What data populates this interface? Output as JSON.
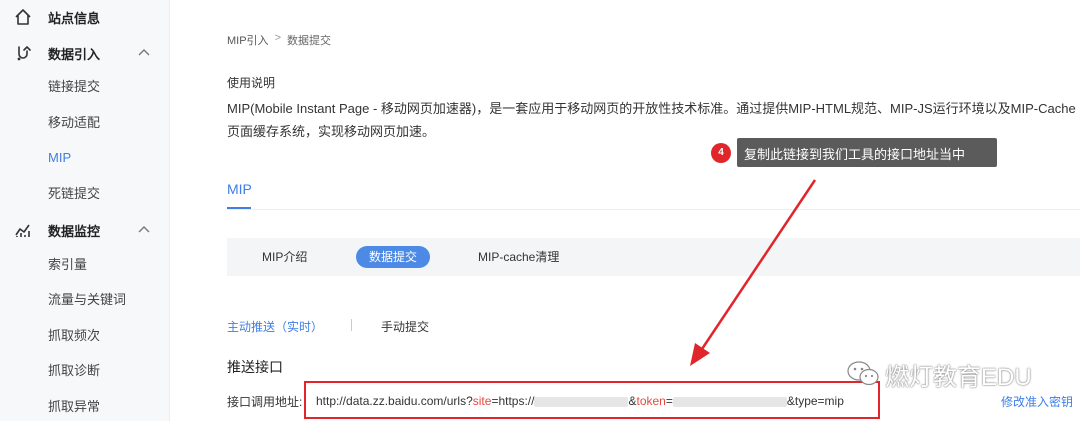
{
  "sidebar": {
    "groups": [
      {
        "label": "站点信息",
        "icon": "home-icon"
      },
      {
        "label": "数据引入",
        "icon": "data-import-icon",
        "items": [
          "链接提交",
          "移动适配",
          "MIP",
          "死链提交"
        ]
      },
      {
        "label": "数据监控",
        "icon": "data-monitor-icon",
        "items": [
          "索引量",
          "流量与关键词",
          "抓取频次",
          "抓取诊断",
          "抓取异常"
        ]
      }
    ],
    "active_item": "MIP"
  },
  "breadcrumb": {
    "parent": "MIP引入",
    "separator": ">",
    "current": "数据提交"
  },
  "usage": {
    "title": "使用说明",
    "text": "MIP(Mobile Instant Page - 移动网页加速器)，是一套应用于移动网页的开放性技术标准。通过提供MIP-HTML规范、MIP-JS运行环境以及MIP-Cache页面缓存系统，实现移动网页加速。"
  },
  "main_tab": "MIP",
  "subtabs": [
    "MIP介绍",
    "数据提交",
    "MIP-cache清理"
  ],
  "active_subtab": "数据提交",
  "push_modes": {
    "auto": "主动推送（实时）",
    "manual": "手动提交"
  },
  "push_section": {
    "title": "推送接口",
    "url_label": "接口调用地址:",
    "url_prefix": "http://data.zz.baidu.com/urls?",
    "site_key": "site",
    "site_eq": "=https://",
    "token_amp": "&",
    "token_key": "token",
    "token_eq": "=",
    "type_part": "&type=mip",
    "edit_link": "修改准入密钥"
  },
  "annotation": {
    "badge": "4",
    "text": "复制此链接到我们工具的接口地址当中",
    "box_color": "#e0262b"
  },
  "watermark": {
    "text": "燃灯教育EDU",
    "icon": "wechat-icon"
  },
  "colors": {
    "accent": "#3e7ee8",
    "annotation_red": "#e0262b"
  }
}
